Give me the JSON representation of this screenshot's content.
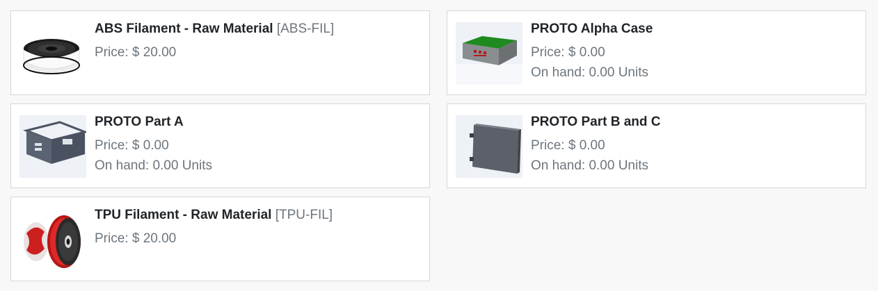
{
  "products": [
    {
      "name": "ABS Filament - Raw Material",
      "code": "[ABS-FIL]",
      "price": "Price: $ 20.00",
      "on_hand": null,
      "image": "white-filament-spool"
    },
    {
      "name": "PROTO Alpha Case",
      "code": null,
      "price": "Price: $ 0.00",
      "on_hand": "On hand: 0.00 Units",
      "image": "green-top-gray-case"
    },
    {
      "name": "PROTO Part A",
      "code": null,
      "price": "Price: $ 0.00",
      "on_hand": "On hand: 0.00 Units",
      "image": "gray-open-box-part"
    },
    {
      "name": "PROTO Part B and C",
      "code": null,
      "price": "Price: $ 0.00",
      "on_hand": "On hand: 0.00 Units",
      "image": "gray-panel-part"
    },
    {
      "name": "TPU Filament - Raw Material",
      "code": "[TPU-FIL]",
      "price": "Price: $ 20.00",
      "on_hand": null,
      "image": "red-filament-spool"
    }
  ],
  "colors": {
    "background": "#f8f8f8",
    "card": "#ffffff",
    "border": "#d6d6d6",
    "title": "#212529",
    "muted": "#6c757d"
  }
}
